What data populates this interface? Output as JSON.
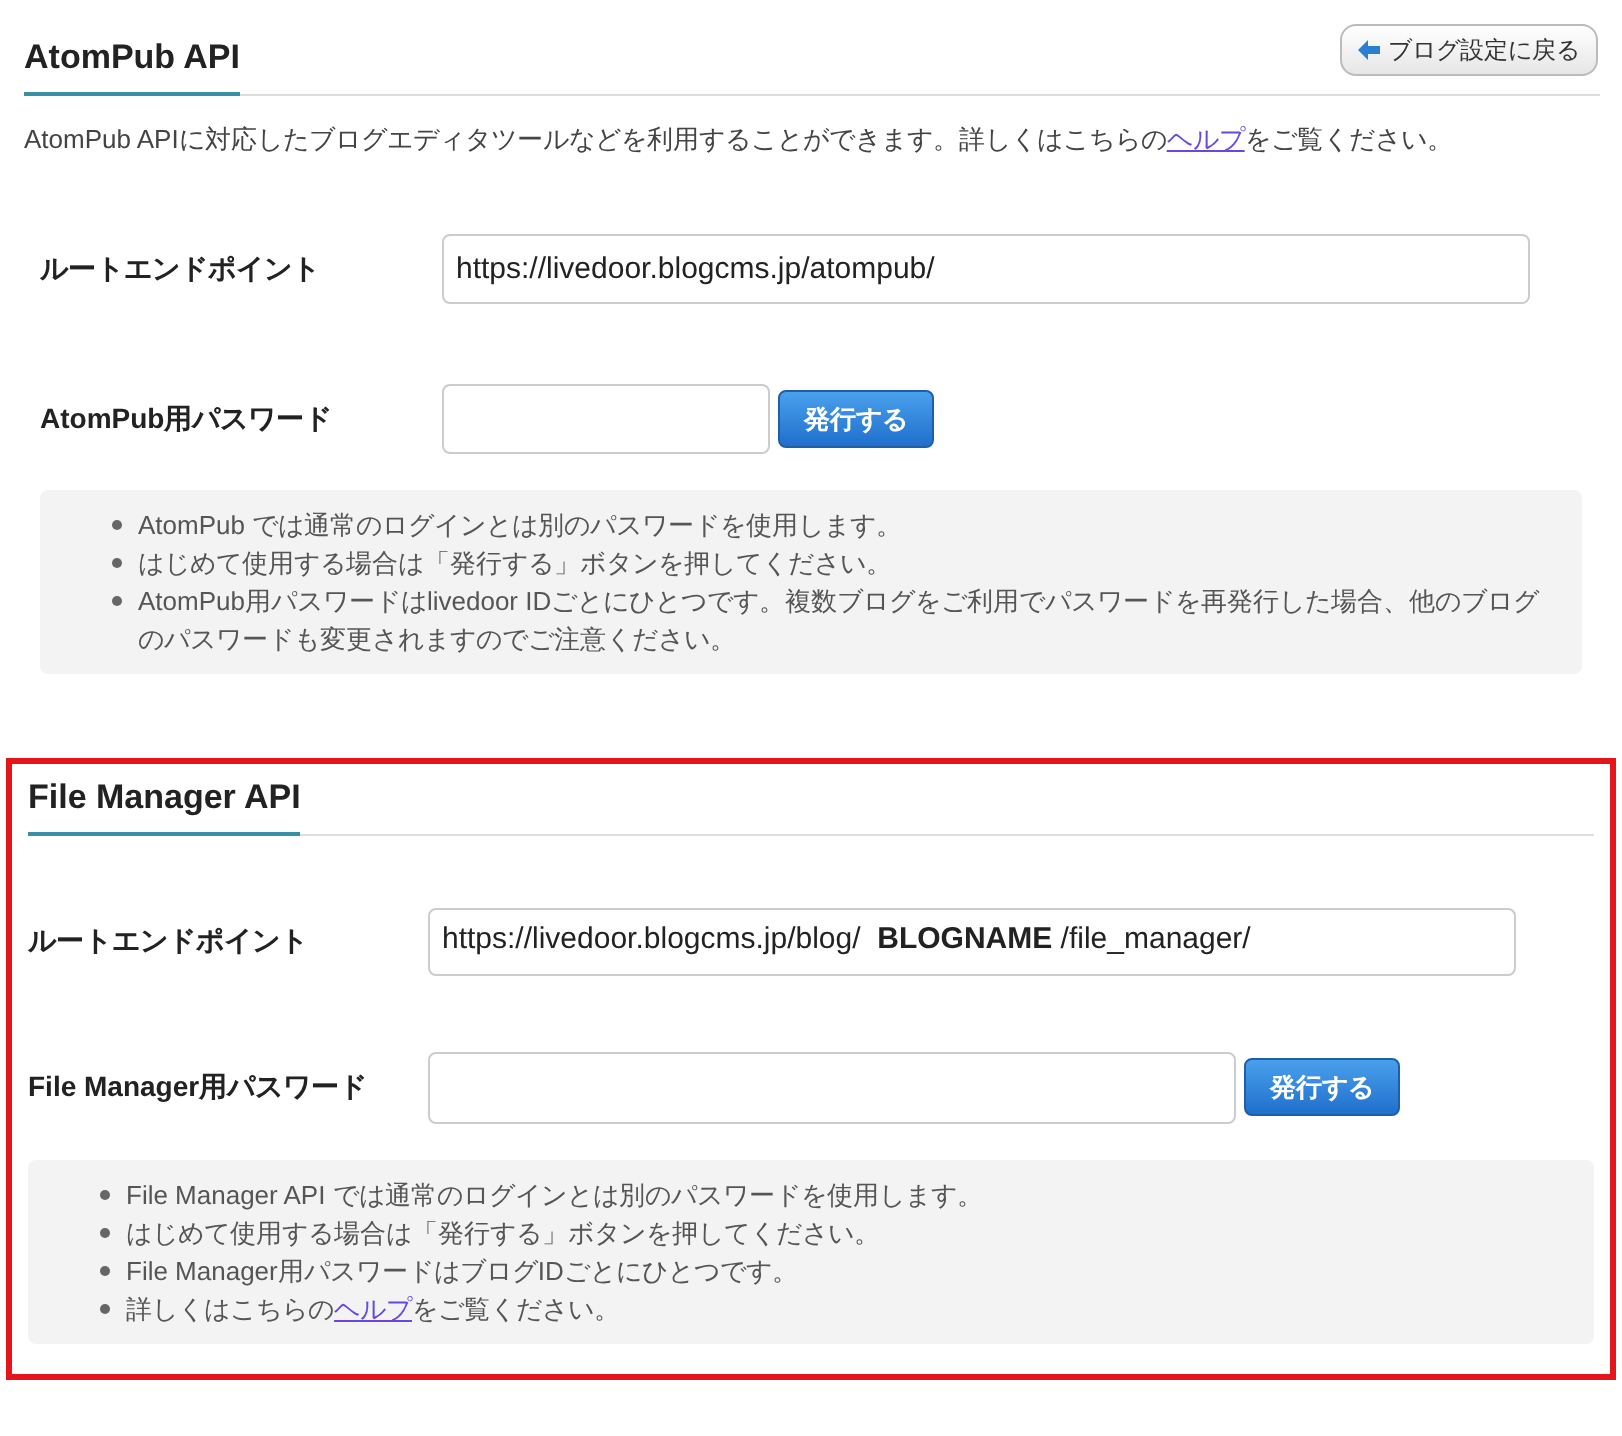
{
  "back_button": {
    "label": "ブログ設定に戻る"
  },
  "atompub": {
    "title": "AtomPub API",
    "description": {
      "before": "AtomPub APIに対応したブログエディタツールなどを利用することができます。詳しくはこちらの",
      "link": "ヘルプ",
      "after": "をご覧ください。"
    },
    "endpoint": {
      "label": "ルートエンドポイント",
      "value": "https://livedoor.blogcms.jp/atompub/"
    },
    "password": {
      "label": "AtomPub用パスワード",
      "button": "発行する"
    },
    "notes": [
      {
        "kind": "text",
        "text": "AtomPub では通常のログインとは別のパスワードを使用します。"
      },
      {
        "kind": "text",
        "text": "はじめて使用する場合は「発行する」ボタンを押してください。"
      },
      {
        "kind": "text",
        "text": "AtomPub用パスワードはlivedoor IDごとにひとつです。複数ブログをご利用でパスワードを再発行した場合、他のブログのパスワードも変更されますのでご注意ください。"
      }
    ]
  },
  "file_manager": {
    "highlighted": true,
    "title": "File Manager API",
    "endpoint": {
      "label": "ルートエンドポイント",
      "value": "https://livedoor.blogcms.jp/blog/  **BLOGNAME** /file_manager/"
    },
    "password": {
      "label": "File Manager用パスワード",
      "button": "発行する"
    },
    "notes": [
      {
        "kind": "text",
        "text": "File Manager API では通常のログインとは別のパスワードを使用します。"
      },
      {
        "kind": "text",
        "text": "はじめて使用する場合は「発行する」ボタンを押してください。"
      },
      {
        "kind": "text",
        "text": "File Manager用パスワードはブログIDごとにひとつです。"
      },
      {
        "kind": "link",
        "before": "詳しくはこちらの",
        "link": "ヘルプ",
        "after": "をご覧ください。"
      }
    ]
  }
}
